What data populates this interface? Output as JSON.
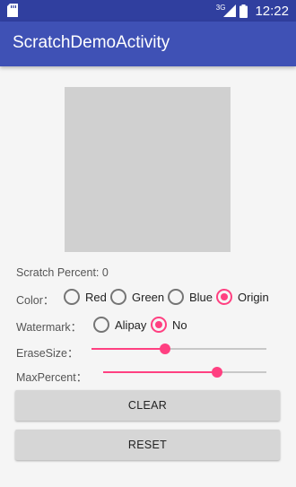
{
  "status_bar": {
    "network": "3G",
    "time": "12:22"
  },
  "app_bar": {
    "title": "ScratchDemoActivity"
  },
  "scratch": {
    "percent_text": "Scratch Percent: 0"
  },
  "color": {
    "label": "Color：",
    "options": [
      {
        "label": "Red",
        "checked": false
      },
      {
        "label": "Green",
        "checked": false
      },
      {
        "label": "Blue",
        "checked": false
      },
      {
        "label": "Origin",
        "checked": true
      }
    ]
  },
  "watermark": {
    "label": "Watermark：",
    "options": [
      {
        "label": "Alipay",
        "checked": false
      },
      {
        "label": "No",
        "checked": true
      }
    ]
  },
  "erase_size": {
    "label": "EraseSize：",
    "value": 0.42
  },
  "max_percent": {
    "label": "MaxPercent：",
    "value": 0.7
  },
  "buttons": {
    "clear": "CLEAR",
    "reset": "RESET"
  },
  "colors": {
    "accent": "#ff4081",
    "app_bar": "#3f51b5",
    "status_bar": "#303f9f",
    "scratch_fill": "#d0d0d0"
  }
}
